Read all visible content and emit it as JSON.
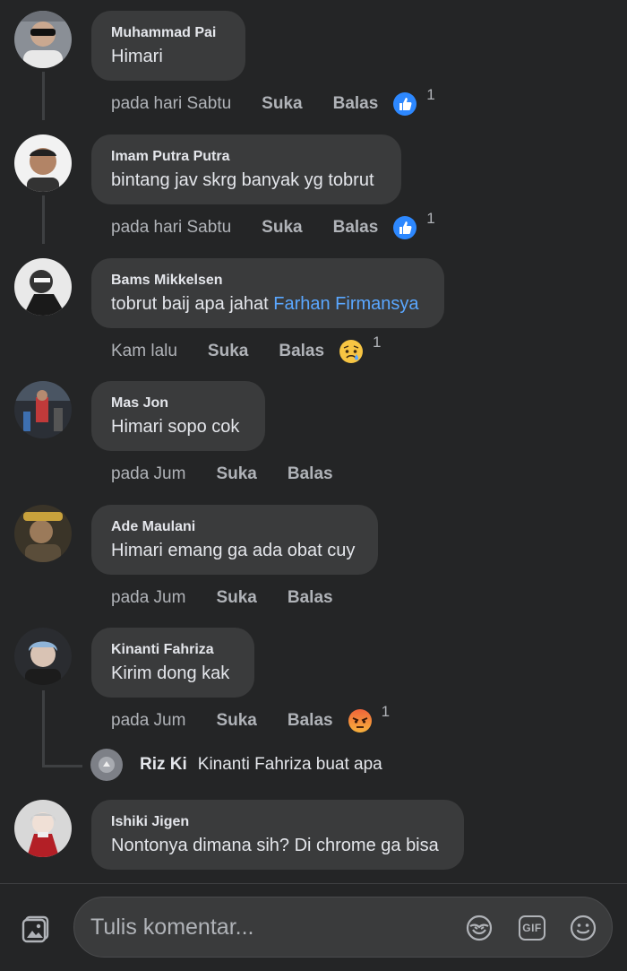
{
  "comments": [
    {
      "author": "Muhammad Pai",
      "text": "Himari",
      "time": "pada hari Sabtu",
      "like": "Suka",
      "reply": "Balas",
      "reaction": "like",
      "reaction_count": "1"
    },
    {
      "author": "Imam Putra Putra",
      "text": "bintang jav skrg banyak yg tobrut",
      "time": "pada hari Sabtu",
      "like": "Suka",
      "reply": "Balas",
      "reaction": "like",
      "reaction_count": "1"
    },
    {
      "author": "Bams Mikkelsen",
      "text": "tobrut baij apa jahat ",
      "mention": "Farhan Firmansya",
      "time": "Kam lalu",
      "like": "Suka",
      "reply": "Balas",
      "reaction": "sad",
      "reaction_count": "1"
    },
    {
      "author": "Mas Jon",
      "text": "Himari sopo cok",
      "time": "pada Jum",
      "like": "Suka",
      "reply": "Balas"
    },
    {
      "author": "Ade Maulani",
      "text": "Himari emang ga ada obat cuy",
      "time": "pada Jum",
      "like": "Suka",
      "reply": "Balas"
    },
    {
      "author": "Kinanti Fahriza",
      "text": "Kirim dong kak",
      "time": "pada Jum",
      "like": "Suka",
      "reply": "Balas",
      "reaction": "angry",
      "reaction_count": "1"
    },
    {
      "author": "Ishiki Jigen",
      "text": "Nontonya dimana sih? Di chrome ga bisa"
    }
  ],
  "reply_preview": {
    "author": "Riz Ki",
    "text": "Kinanti Fahriza buat apa"
  },
  "composer": {
    "placeholder": "Tulis komentar...",
    "photo_icon": "photo-icon",
    "sticker_icon": "sticker-icon",
    "gif_label": "GIF",
    "emoji_icon": "emoji-icon"
  },
  "colors": {
    "background": "#242526",
    "bubble": "#3a3b3c",
    "text": "#e4e6eb",
    "secondary": "#b0b3b8",
    "mention": "#5aa7ff",
    "like_blue": "#2d88ff",
    "angry": "#f0643a",
    "sad_yellow": "#f7c543"
  }
}
